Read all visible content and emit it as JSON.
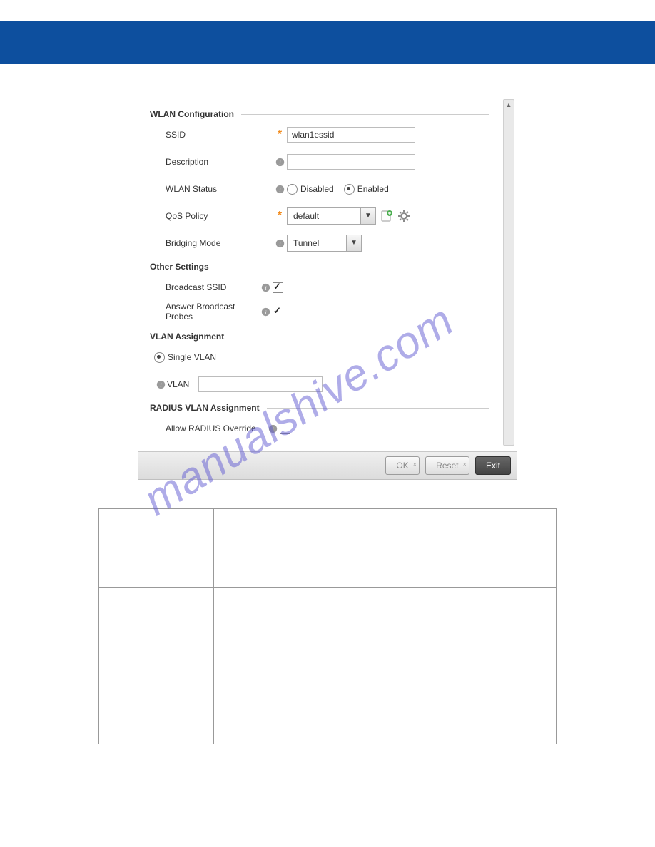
{
  "watermark": "manualshive.com",
  "dialog": {
    "sections": {
      "wlan_config": {
        "title": "WLAN Configuration",
        "ssid_label": "SSID",
        "ssid_value": "wlan1essid",
        "description_label": "Description",
        "description_value": "",
        "wlan_status_label": "WLAN Status",
        "status_disabled": "Disabled",
        "status_enabled": "Enabled",
        "qos_policy_label": "QoS Policy",
        "qos_policy_value": "default",
        "bridging_mode_label": "Bridging Mode",
        "bridging_mode_value": "Tunnel"
      },
      "other_settings": {
        "title": "Other Settings",
        "broadcast_ssid_label": "Broadcast SSID",
        "answer_probes_label": "Answer Broadcast Probes"
      },
      "vlan_assignment": {
        "title": "VLAN Assignment",
        "single_vlan_label": "Single VLAN",
        "vlan_label": "VLAN",
        "vlan_value": ""
      },
      "radius_vlan": {
        "title": "RADIUS VLAN Assignment",
        "allow_override_label": "Allow RADIUS Override"
      }
    },
    "footer": {
      "ok": "OK",
      "reset": "Reset",
      "exit": "Exit"
    }
  }
}
